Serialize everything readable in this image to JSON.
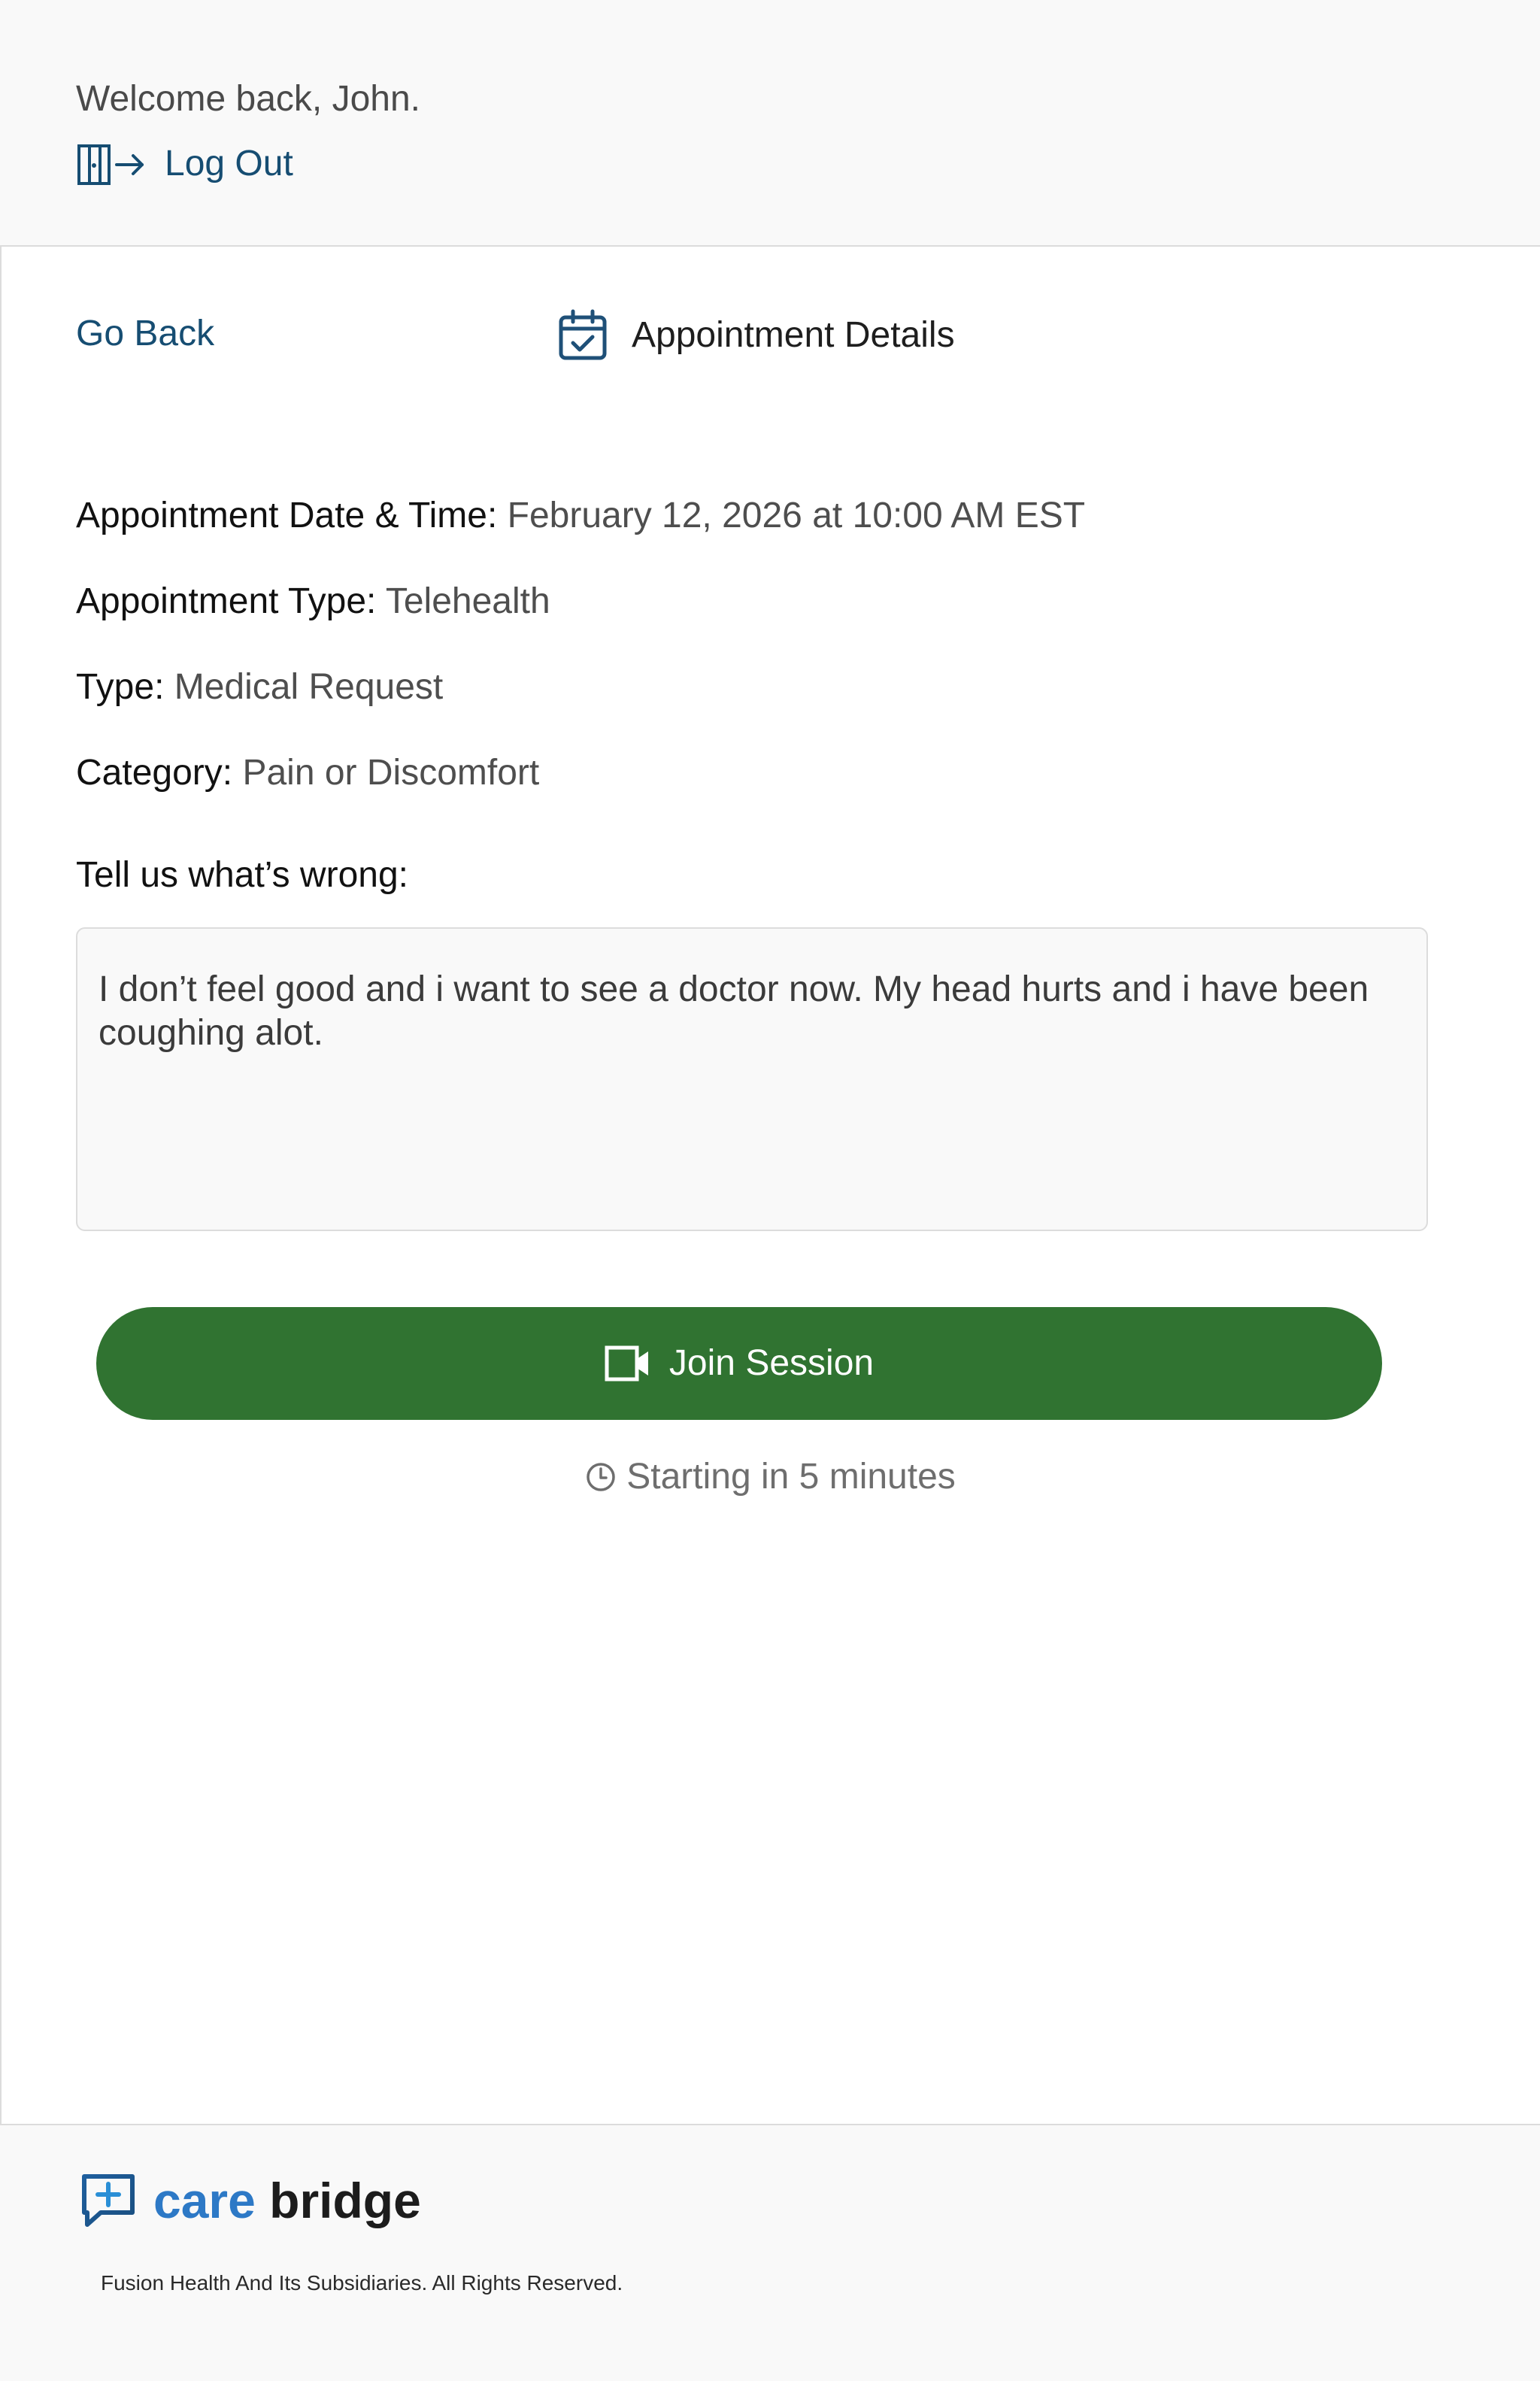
{
  "header": {
    "welcome_text": "Welcome back, John.",
    "logout_label": "Log Out",
    "logout_icon": "door-exit-icon"
  },
  "nav": {
    "go_back_label": "Go Back",
    "page_title": "Appointment Details",
    "title_icon": "calendar-check-icon"
  },
  "details": {
    "date_time": {
      "label": "Appointment Date & Time:",
      "value": "February 12, 2026 at 10:00 AM EST"
    },
    "appointment_type": {
      "label": "Appointment Type:",
      "value": "Telehealth"
    },
    "type": {
      "label": "Type:",
      "value": "Medical Request"
    },
    "category": {
      "label": "Category:",
      "value": "Pain or Discomfort"
    }
  },
  "complaint": {
    "label": "Tell us what’s wrong:",
    "value": "I don’t feel good and i want to see a doctor now. My head hurts and i have been coughing alot."
  },
  "session": {
    "join_label": "Join Session",
    "join_icon": "video-camera-icon",
    "status_text": "Starting in 5 minutes",
    "status_icon": "clock-icon"
  },
  "footer": {
    "brand_care": "care",
    "brand_bridge": "bridge",
    "brand_icon": "chat-plus-icon",
    "copyright": "Fusion Health And Its Subsidiaries. All Rights Reserved."
  },
  "colors": {
    "link_blue": "#164d72",
    "join_green": "#307331",
    "brand_blue": "#2d79c6",
    "brand_purple": "#7b55c9"
  }
}
